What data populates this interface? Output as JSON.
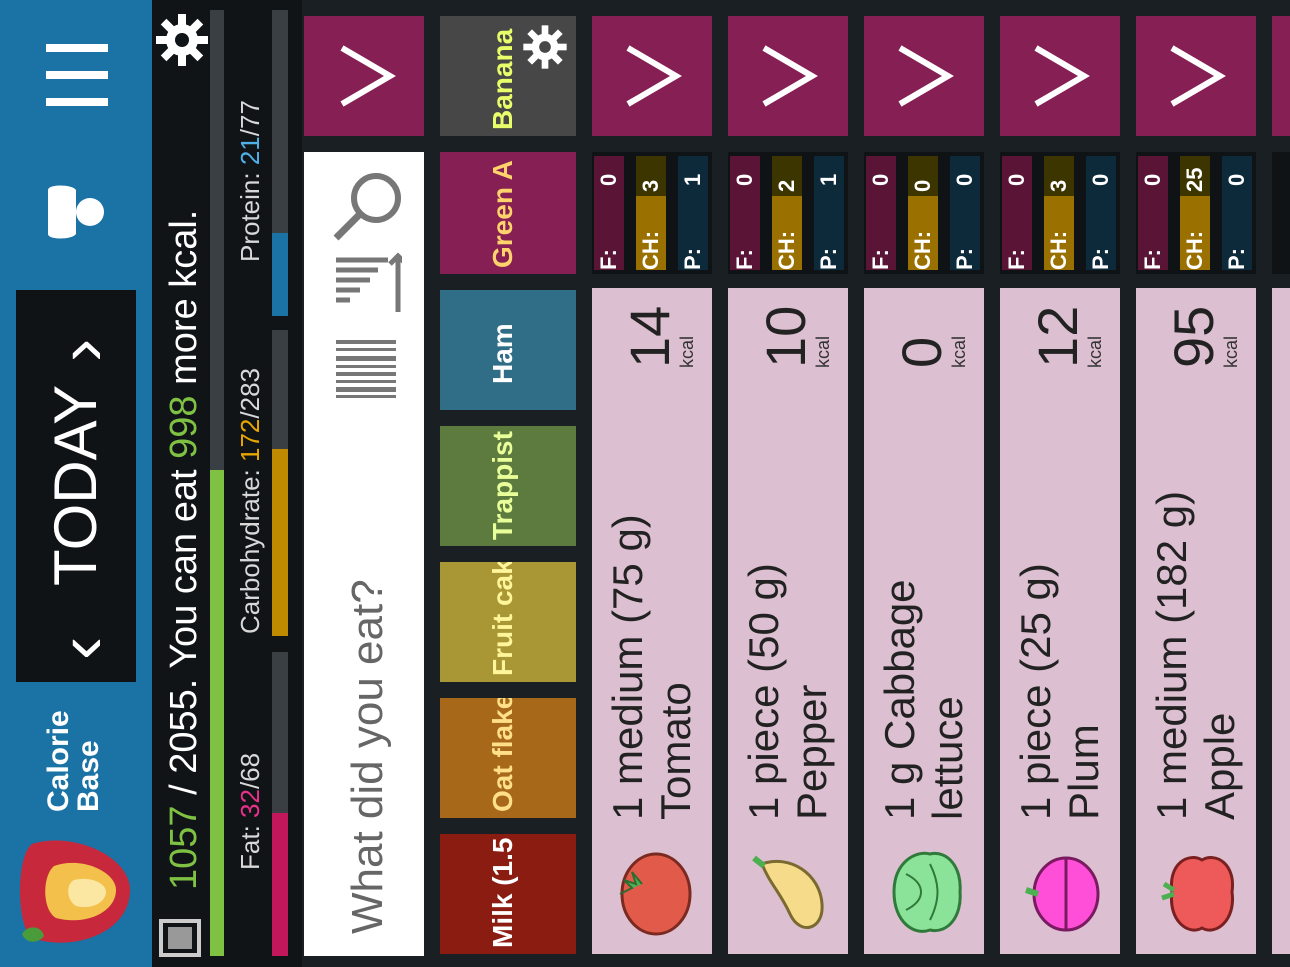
{
  "app": {
    "name_line1": "Calorie",
    "name_line2": "Base",
    "icons": {
      "logo": "apple-heart-logo",
      "profile": "person-icon",
      "menu": "menu-bars-icon",
      "settings": "gear-icon"
    }
  },
  "header": {
    "day_label": "TODAY",
    "prev": "‹",
    "next": "›"
  },
  "summary": {
    "eaten": "1057",
    "goal": "/ 2055.",
    "message_pre": "You can eat",
    "remaining": "998",
    "message_post": "more kcal.",
    "progress_fraction": 0.514
  },
  "macros": {
    "fat": {
      "label": "Fat:",
      "value": "32",
      "max": "/68",
      "fraction": 0.47,
      "color": "#c2185b"
    },
    "carb": {
      "label": "Carbohydrate:",
      "value": "172",
      "max": "/283",
      "fraction": 0.61,
      "color": "#c08a00"
    },
    "protein": {
      "label": "Protein:",
      "value": "21",
      "max": "/77",
      "fraction": 0.27,
      "color": "#1a73a4"
    }
  },
  "search": {
    "placeholder": "What did you eat?",
    "icons": [
      "search-icon",
      "sort-icon",
      "barcode-icon"
    ]
  },
  "categories": [
    {
      "label": "Milk (1.5",
      "bg": "#8a1c12",
      "fg": "#ffffff"
    },
    {
      "label": "Oat flake",
      "bg": "#a76919",
      "fg": "#ffe089"
    },
    {
      "label": "Fruit cak",
      "bg": "#a99634",
      "fg": "#fff59a"
    },
    {
      "label": "Trappist",
      "bg": "#5d7a3f",
      "fg": "#e9ff9a"
    },
    {
      "label": "Ham",
      "bg": "#2f6e86",
      "fg": "#ffffff"
    },
    {
      "label": "Green A",
      "bg": "#861f53",
      "fg": "#ffd36b"
    },
    {
      "label": "Banana",
      "bg": "#474747",
      "fg": "#e8ff6a"
    }
  ],
  "foods": [
    {
      "line1": "1 medium (75 g)",
      "line2": "Tomato",
      "kcal": "14",
      "kcal_unit": "kcal",
      "fat_label": "F:",
      "fat": "0",
      "carb_label": "CH:",
      "carb": "3",
      "prot_label": "P:",
      "prot": "1",
      "icon": "tomato-icon"
    },
    {
      "line1": "1 piece (50 g)",
      "line2": "Pepper",
      "kcal": "10",
      "kcal_unit": "kcal",
      "fat_label": "F:",
      "fat": "0",
      "carb_label": "CH:",
      "carb": "2",
      "prot_label": "P:",
      "prot": "1",
      "icon": "pepper-icon"
    },
    {
      "line1": "1 g Cabbage",
      "line2": "lettuce",
      "kcal": "0",
      "kcal_unit": "kcal",
      "fat_label": "F:",
      "fat": "0",
      "carb_label": "CH:",
      "carb": "0",
      "prot_label": "P:",
      "prot": "0",
      "icon": "lettuce-icon"
    },
    {
      "line1": "1 piece (25 g)",
      "line2": "Plum",
      "kcal": "12",
      "kcal_unit": "kcal",
      "fat_label": "F:",
      "fat": "0",
      "carb_label": "CH:",
      "carb": "3",
      "prot_label": "P:",
      "prot": "0",
      "icon": "plum-icon"
    },
    {
      "line1": "1 medium (182 g)",
      "line2": "Apple",
      "kcal": "95",
      "kcal_unit": "kcal",
      "fat_label": "F:",
      "fat": "0",
      "carb_label": "CH:",
      "carb": "25",
      "prot_label": "P:",
      "prot": "0",
      "icon": "apple-icon"
    }
  ],
  "colors": {
    "header": "#1a73a4",
    "accent": "#861f53",
    "card_body": "#dcbfd0",
    "kcal_green": "#7fc243"
  }
}
